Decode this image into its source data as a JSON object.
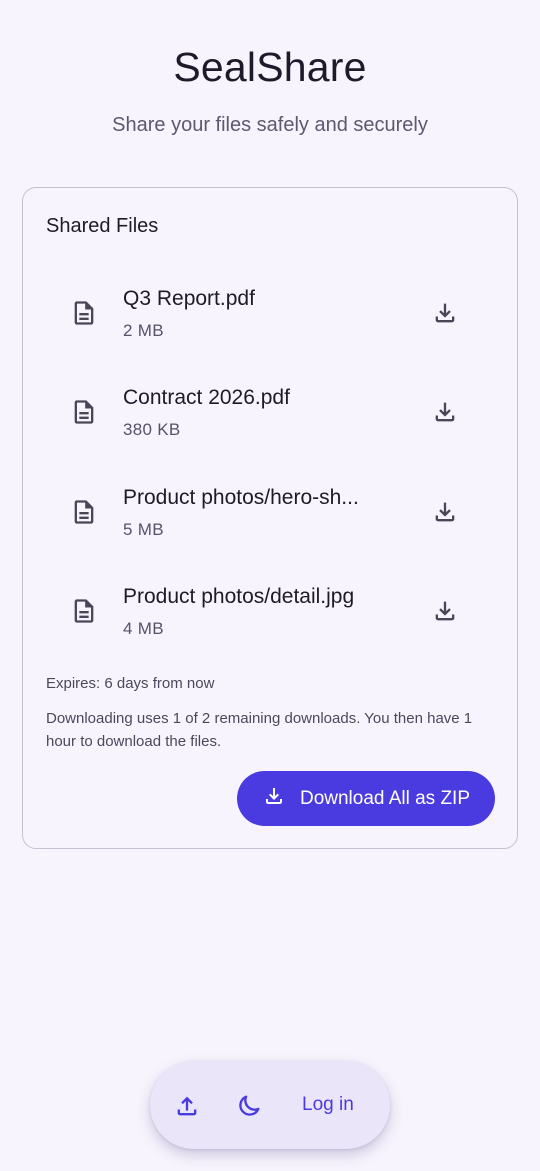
{
  "app": {
    "title": "SealShare",
    "subtitle": "Share your files safely and securely"
  },
  "card": {
    "title": "Shared Files",
    "files": [
      {
        "name": "Q3 Report.pdf",
        "size": "2 MB",
        "icon": "document-icon",
        "action_icon": "download-icon"
      },
      {
        "name": "Contract 2026.pdf",
        "size": "380 KB",
        "icon": "document-icon",
        "action_icon": "download-icon"
      },
      {
        "name": "Product photos/hero-sh...",
        "size": "5 MB",
        "icon": "document-icon",
        "action_icon": "download-icon"
      },
      {
        "name": "Product photos/detail.jpg",
        "size": "4 MB",
        "icon": "document-icon",
        "action_icon": "download-icon"
      }
    ],
    "expires": "Expires: 6 days from now",
    "download_note": "Downloading uses 1 of 2 remaining downloads. You then have 1 hour to download the files.",
    "zip_button_label": "Download All as ZIP"
  },
  "bottom_bar": {
    "upload_icon": "upload-icon",
    "theme_icon": "moon-icon",
    "login_label": "Log in"
  },
  "colors": {
    "background": "#f8f4fd",
    "accent": "#4a3be0",
    "bar_background": "#ebe5fa"
  }
}
